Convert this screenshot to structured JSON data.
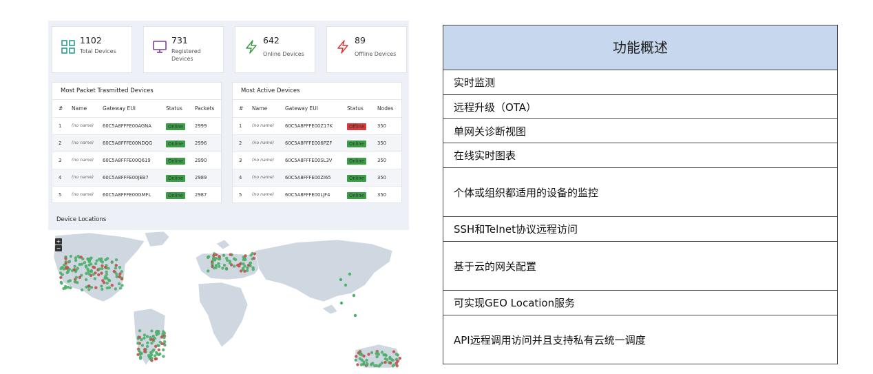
{
  "stats": [
    {
      "value": "1102",
      "label": "Total Devices",
      "icon": "grid-icon",
      "color": "#2a9d8f"
    },
    {
      "value": "731",
      "label": "Registered Devices",
      "icon": "monitor-icon",
      "color": "#7b3fa0"
    },
    {
      "value": "642",
      "label": "Online Devices",
      "icon": "bolt-icon",
      "color": "#3c9d47"
    },
    {
      "value": "89",
      "label": "Offline Devices",
      "icon": "bolt-icon",
      "color": "#d63a3a"
    }
  ],
  "packet_table": {
    "title": "Most Packet Trasmitted Devices",
    "headers": [
      "#",
      "Name",
      "Gateway EUI",
      "Status",
      "Packets"
    ],
    "rows": [
      [
        "1",
        "(no name)",
        "60C5A8FFFE00AGNA",
        "Online",
        "2999"
      ],
      [
        "2",
        "(no name)",
        "60C5A8FFFE00NDQG",
        "Online",
        "2996"
      ],
      [
        "3",
        "(no name)",
        "60C5A8FFFE00Q619",
        "Online",
        "2990"
      ],
      [
        "4",
        "(no name)",
        "60C5A8FFFE00JEB7",
        "Online",
        "2989"
      ],
      [
        "5",
        "(no name)",
        "60C5A8FFFE00GMFL",
        "Online",
        "2987"
      ]
    ]
  },
  "active_table": {
    "title": "Most Active Devices",
    "headers": [
      "#",
      "Name",
      "Gateway EUI",
      "Status",
      "Nodes"
    ],
    "rows": [
      [
        "1",
        "(no name)",
        "60C5A8FFFE00Z17K",
        "Offline",
        "350"
      ],
      [
        "2",
        "(no name)",
        "60C5A8FFFE006PZF",
        "Online",
        "350"
      ],
      [
        "3",
        "(no name)",
        "60C5A8FFFE00SL3V",
        "Online",
        "350"
      ],
      [
        "4",
        "(no name)",
        "60C5A8FFFE00ZI65",
        "Online",
        "350"
      ],
      [
        "5",
        "(no name)",
        "60C5A8FFFE00LJF4",
        "Online",
        "350"
      ]
    ]
  },
  "map": {
    "title": "Device Locations",
    "zoom_in": "+",
    "zoom_out": "−",
    "online_color": "#4caf6a",
    "offline_color": "#c0504d",
    "land_color": "#cfd8e0"
  },
  "features": {
    "title": "功能概述",
    "items": [
      "实时监测",
      "远程升级（OTA）",
      "单网关诊断视图",
      "在线实时图表",
      "个体或组织都适用的设备的监控",
      "SSH和Telnet协议远程访问",
      "基于云的网关配置",
      "可实现GEO Location服务",
      "API远程调用访问并且支持私有云统一调度"
    ]
  }
}
